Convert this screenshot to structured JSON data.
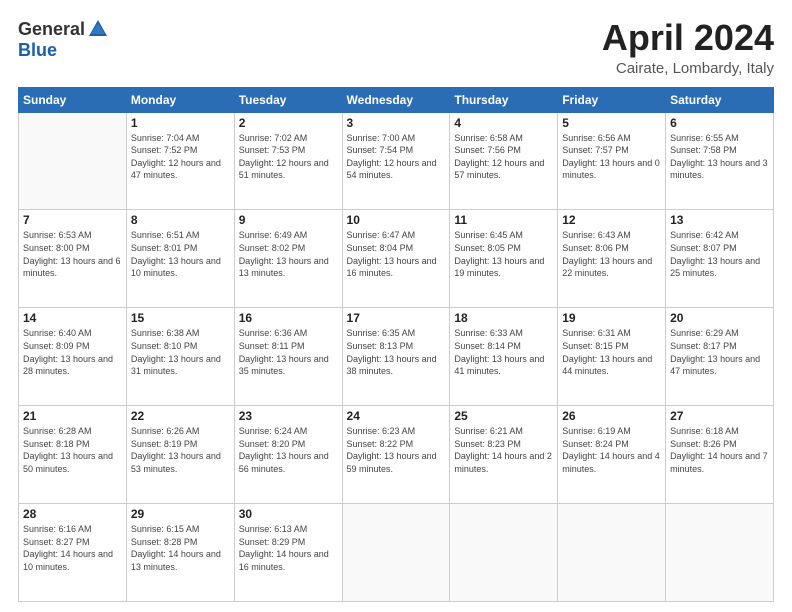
{
  "header": {
    "logo_general": "General",
    "logo_blue": "Blue",
    "month_title": "April 2024",
    "location": "Cairate, Lombardy, Italy"
  },
  "weekdays": [
    "Sunday",
    "Monday",
    "Tuesday",
    "Wednesday",
    "Thursday",
    "Friday",
    "Saturday"
  ],
  "weeks": [
    [
      {
        "day": "",
        "sunrise": "",
        "sunset": "",
        "daylight": ""
      },
      {
        "day": "1",
        "sunrise": "Sunrise: 7:04 AM",
        "sunset": "Sunset: 7:52 PM",
        "daylight": "Daylight: 12 hours and 47 minutes."
      },
      {
        "day": "2",
        "sunrise": "Sunrise: 7:02 AM",
        "sunset": "Sunset: 7:53 PM",
        "daylight": "Daylight: 12 hours and 51 minutes."
      },
      {
        "day": "3",
        "sunrise": "Sunrise: 7:00 AM",
        "sunset": "Sunset: 7:54 PM",
        "daylight": "Daylight: 12 hours and 54 minutes."
      },
      {
        "day": "4",
        "sunrise": "Sunrise: 6:58 AM",
        "sunset": "Sunset: 7:56 PM",
        "daylight": "Daylight: 12 hours and 57 minutes."
      },
      {
        "day": "5",
        "sunrise": "Sunrise: 6:56 AM",
        "sunset": "Sunset: 7:57 PM",
        "daylight": "Daylight: 13 hours and 0 minutes."
      },
      {
        "day": "6",
        "sunrise": "Sunrise: 6:55 AM",
        "sunset": "Sunset: 7:58 PM",
        "daylight": "Daylight: 13 hours and 3 minutes."
      }
    ],
    [
      {
        "day": "7",
        "sunrise": "Sunrise: 6:53 AM",
        "sunset": "Sunset: 8:00 PM",
        "daylight": "Daylight: 13 hours and 6 minutes."
      },
      {
        "day": "8",
        "sunrise": "Sunrise: 6:51 AM",
        "sunset": "Sunset: 8:01 PM",
        "daylight": "Daylight: 13 hours and 10 minutes."
      },
      {
        "day": "9",
        "sunrise": "Sunrise: 6:49 AM",
        "sunset": "Sunset: 8:02 PM",
        "daylight": "Daylight: 13 hours and 13 minutes."
      },
      {
        "day": "10",
        "sunrise": "Sunrise: 6:47 AM",
        "sunset": "Sunset: 8:04 PM",
        "daylight": "Daylight: 13 hours and 16 minutes."
      },
      {
        "day": "11",
        "sunrise": "Sunrise: 6:45 AM",
        "sunset": "Sunset: 8:05 PM",
        "daylight": "Daylight: 13 hours and 19 minutes."
      },
      {
        "day": "12",
        "sunrise": "Sunrise: 6:43 AM",
        "sunset": "Sunset: 8:06 PM",
        "daylight": "Daylight: 13 hours and 22 minutes."
      },
      {
        "day": "13",
        "sunrise": "Sunrise: 6:42 AM",
        "sunset": "Sunset: 8:07 PM",
        "daylight": "Daylight: 13 hours and 25 minutes."
      }
    ],
    [
      {
        "day": "14",
        "sunrise": "Sunrise: 6:40 AM",
        "sunset": "Sunset: 8:09 PM",
        "daylight": "Daylight: 13 hours and 28 minutes."
      },
      {
        "day": "15",
        "sunrise": "Sunrise: 6:38 AM",
        "sunset": "Sunset: 8:10 PM",
        "daylight": "Daylight: 13 hours and 31 minutes."
      },
      {
        "day": "16",
        "sunrise": "Sunrise: 6:36 AM",
        "sunset": "Sunset: 8:11 PM",
        "daylight": "Daylight: 13 hours and 35 minutes."
      },
      {
        "day": "17",
        "sunrise": "Sunrise: 6:35 AM",
        "sunset": "Sunset: 8:13 PM",
        "daylight": "Daylight: 13 hours and 38 minutes."
      },
      {
        "day": "18",
        "sunrise": "Sunrise: 6:33 AM",
        "sunset": "Sunset: 8:14 PM",
        "daylight": "Daylight: 13 hours and 41 minutes."
      },
      {
        "day": "19",
        "sunrise": "Sunrise: 6:31 AM",
        "sunset": "Sunset: 8:15 PM",
        "daylight": "Daylight: 13 hours and 44 minutes."
      },
      {
        "day": "20",
        "sunrise": "Sunrise: 6:29 AM",
        "sunset": "Sunset: 8:17 PM",
        "daylight": "Daylight: 13 hours and 47 minutes."
      }
    ],
    [
      {
        "day": "21",
        "sunrise": "Sunrise: 6:28 AM",
        "sunset": "Sunset: 8:18 PM",
        "daylight": "Daylight: 13 hours and 50 minutes."
      },
      {
        "day": "22",
        "sunrise": "Sunrise: 6:26 AM",
        "sunset": "Sunset: 8:19 PM",
        "daylight": "Daylight: 13 hours and 53 minutes."
      },
      {
        "day": "23",
        "sunrise": "Sunrise: 6:24 AM",
        "sunset": "Sunset: 8:20 PM",
        "daylight": "Daylight: 13 hours and 56 minutes."
      },
      {
        "day": "24",
        "sunrise": "Sunrise: 6:23 AM",
        "sunset": "Sunset: 8:22 PM",
        "daylight": "Daylight: 13 hours and 59 minutes."
      },
      {
        "day": "25",
        "sunrise": "Sunrise: 6:21 AM",
        "sunset": "Sunset: 8:23 PM",
        "daylight": "Daylight: 14 hours and 2 minutes."
      },
      {
        "day": "26",
        "sunrise": "Sunrise: 6:19 AM",
        "sunset": "Sunset: 8:24 PM",
        "daylight": "Daylight: 14 hours and 4 minutes."
      },
      {
        "day": "27",
        "sunrise": "Sunrise: 6:18 AM",
        "sunset": "Sunset: 8:26 PM",
        "daylight": "Daylight: 14 hours and 7 minutes."
      }
    ],
    [
      {
        "day": "28",
        "sunrise": "Sunrise: 6:16 AM",
        "sunset": "Sunset: 8:27 PM",
        "daylight": "Daylight: 14 hours and 10 minutes."
      },
      {
        "day": "29",
        "sunrise": "Sunrise: 6:15 AM",
        "sunset": "Sunset: 8:28 PM",
        "daylight": "Daylight: 14 hours and 13 minutes."
      },
      {
        "day": "30",
        "sunrise": "Sunrise: 6:13 AM",
        "sunset": "Sunset: 8:29 PM",
        "daylight": "Daylight: 14 hours and 16 minutes."
      },
      {
        "day": "",
        "sunrise": "",
        "sunset": "",
        "daylight": ""
      },
      {
        "day": "",
        "sunrise": "",
        "sunset": "",
        "daylight": ""
      },
      {
        "day": "",
        "sunrise": "",
        "sunset": "",
        "daylight": ""
      },
      {
        "day": "",
        "sunrise": "",
        "sunset": "",
        "daylight": ""
      }
    ]
  ]
}
